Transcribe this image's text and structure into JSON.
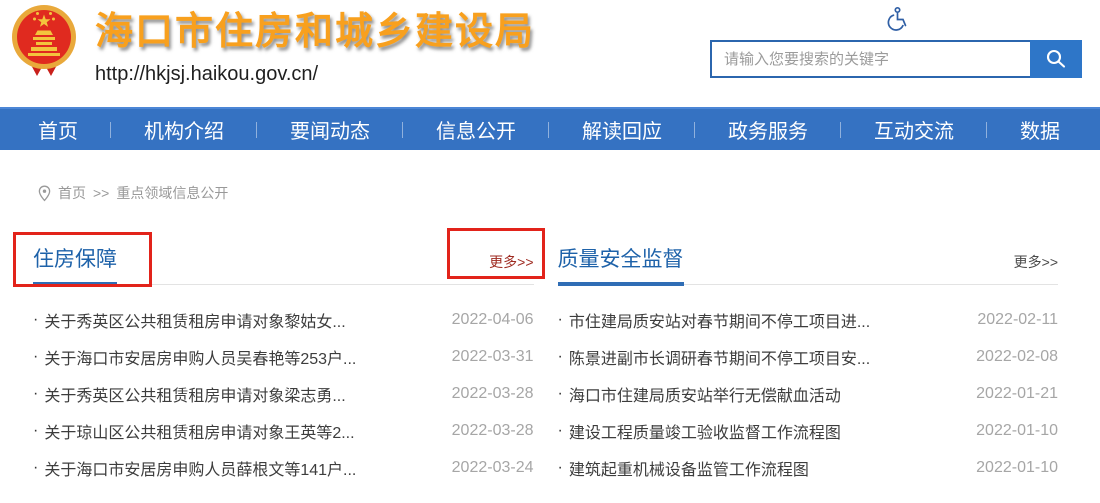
{
  "header": {
    "site_title": "海口市住房和城乡建设局",
    "site_url": "http://hkjsj.haikou.gov.cn/",
    "search": {
      "placeholder": "请输入您要搜索的关键字"
    }
  },
  "nav": {
    "items": [
      "首页",
      "机构介绍",
      "要闻动态",
      "信息公开",
      "解读回应",
      "政务服务",
      "互动交流",
      "数据"
    ]
  },
  "breadcrumb": {
    "home": "首页",
    "separator": ">>",
    "current": "重点领域信息公开"
  },
  "list": {
    "bullet": "·"
  },
  "sections": [
    {
      "title": "住房保障",
      "more_label": "更多>>",
      "items": [
        {
          "title": "关于秀英区公共租赁租房申请对象黎姑女...",
          "date": "2022-04-06"
        },
        {
          "title": "关于海口市安居房申购人员吴春艳等253户...",
          "date": "2022-03-31"
        },
        {
          "title": "关于秀英区公共租赁租房申请对象梁志勇...",
          "date": "2022-03-28"
        },
        {
          "title": "关于琼山区公共租赁租房申请对象王英等2...",
          "date": "2022-03-28"
        },
        {
          "title": "关于海口市安居房申购人员薛根文等141户...",
          "date": "2022-03-24"
        }
      ]
    },
    {
      "title": "质量安全监督",
      "more_label": "更多>>",
      "items": [
        {
          "title": "市住建局质安站对春节期间不停工项目进...",
          "date": "2022-02-11"
        },
        {
          "title": "陈景进副市长调研春节期间不停工项目安...",
          "date": "2022-02-08"
        },
        {
          "title": "海口市住建局质安站举行无偿献血活动",
          "date": "2022-01-21"
        },
        {
          "title": "建设工程质量竣工验收监督工作流程图",
          "date": "2022-01-10"
        },
        {
          "title": "建筑起重机械设备监管工作流程图",
          "date": "2022-01-10"
        }
      ]
    }
  ],
  "colors": {
    "accent_blue": "#3572C2",
    "title_gold": "#F8A01E",
    "section_blue": "#1E62A9",
    "more_red": "#9E2A20",
    "annotation_red": "#E2231A",
    "date_gray": "#A6A6A6"
  }
}
